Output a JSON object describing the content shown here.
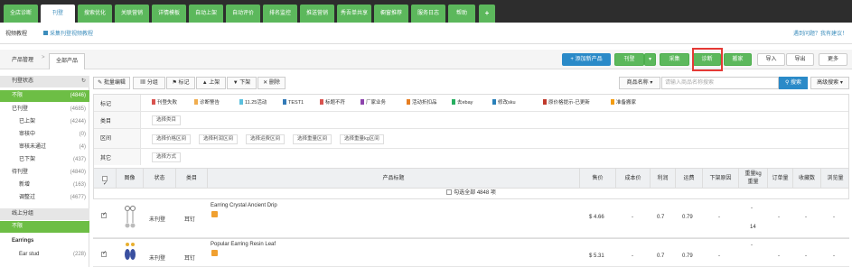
{
  "topnav": {
    "tabs": [
      "全店诊断",
      "刊登",
      "搜索优化",
      "关联营销",
      "详情模板",
      "自动上架",
      "自动评价",
      "排名监控",
      "推送营销",
      "秀吾单共享",
      "橱窗推荐",
      "服务日志",
      "帮助",
      "+"
    ],
    "active": 1
  },
  "subbar": {
    "tutorial": "视频教程",
    "video_link": "采集刊登视频教程",
    "feedback": "遇到问题？我有建议！"
  },
  "crumb": {
    "root": "产品管理",
    "sep": ">",
    "current": "全部产品"
  },
  "actions": {
    "add": "+ 添加新产品",
    "publish": "刊登",
    "collect": "采集",
    "diagnose": "诊断",
    "relocate": "搬家",
    "import": "导入",
    "export": "导出",
    "advanced": "更多"
  },
  "sidebar": {
    "title": "刊登状态",
    "items": [
      {
        "label": "刊登状态",
        "count": "",
        "type": "head"
      },
      {
        "label": "不限",
        "count": "(4846)",
        "type": "sel"
      },
      {
        "label": "已刊登",
        "count": "(4685)",
        "type": "top"
      },
      {
        "label": "已上架",
        "count": "(4244)",
        "type": "sub"
      },
      {
        "label": "审核中",
        "count": "(0)",
        "type": "sub"
      },
      {
        "label": "审核未通过",
        "count": "(4)",
        "type": "sub"
      },
      {
        "label": "已下架",
        "count": "(437)",
        "type": "sub"
      },
      {
        "label": "待刊登",
        "count": "(4840)",
        "type": "top"
      },
      {
        "label": "新增",
        "count": "(163)",
        "type": "sub"
      },
      {
        "label": "调整过",
        "count": "(4677)",
        "type": "sub"
      },
      {
        "label": "线上分组",
        "count": "",
        "type": "head"
      },
      {
        "label": "不限",
        "count": "",
        "type": "sel"
      },
      {
        "label": "Earrings",
        "count": "",
        "type": "bold"
      },
      {
        "label": "Ear stud",
        "count": "(228)",
        "type": "sub"
      }
    ]
  },
  "toolbar": {
    "batch_edit": "批量编辑",
    "group": "分组",
    "tag": "标记",
    "up": "上架",
    "down": "下架",
    "delete": "删除",
    "search_scope": "商品名称",
    "search_placeholder": "请输入商品名称搜索",
    "search": "搜索",
    "advanced_search": "高级搜索"
  },
  "filters": {
    "tag_label": "标记",
    "tags": [
      {
        "label": "刊登失败",
        "color": "#d9534f"
      },
      {
        "label": "诊断警告",
        "color": "#f0ad4e"
      },
      {
        "label": "11.25活动",
        "color": "#5bc0de"
      },
      {
        "label": "TEST1",
        "color": "#337ab7"
      },
      {
        "label": "标题不符",
        "color": "#d9534f"
      },
      {
        "label": "厂家业务",
        "color": "#8e44ad"
      },
      {
        "label": "活动折扣品",
        "color": "#e67e22"
      },
      {
        "label": "去ebay",
        "color": "#27ae60"
      },
      {
        "label": "修改sku",
        "color": "#2980b9"
      },
      {
        "label": "原价格提示-已更新",
        "color": "#c0392b"
      },
      {
        "label": "准备搬家",
        "color": "#f39c12"
      }
    ],
    "category_label": "类目",
    "category_option": "选择类目",
    "range_label": "区间",
    "ranges": [
      "选择价格区间",
      "选择利润区间",
      "选择运费区间",
      "选择重量区间",
      "选择重量kg区间"
    ],
    "other_label": "其它",
    "other_option": "选择方式"
  },
  "table": {
    "headers": [
      "",
      "图像",
      "状态",
      "类目",
      "产品标题",
      "售价",
      "成本价",
      "利润",
      "运费",
      "下架原因",
      "重量kg\n重量",
      "订单量",
      "收藏数",
      "浏览量"
    ],
    "select_all": "勾选全部 4848 项",
    "rows": [
      {
        "checked": true,
        "status": "未刊登",
        "category": "耳钉",
        "title": "Earring Crystal Ancient Drip",
        "price": "$ 4.66",
        "cost": "-",
        "profit": "0.7",
        "freight": "0.79",
        "reason": "-",
        "weight": "-",
        "weight2": "14",
        "orders": "-",
        "favs": "-",
        "views": "-"
      },
      {
        "checked": true,
        "status": "未刊登",
        "category": "耳钉",
        "title": "Popular Earring Resin Leaf",
        "price": "$ 5.31",
        "cost": "-",
        "profit": "0.7",
        "freight": "0.79",
        "reason": "-",
        "weight": "-",
        "weight2": "",
        "orders": "-",
        "favs": "-",
        "views": "-"
      }
    ]
  }
}
